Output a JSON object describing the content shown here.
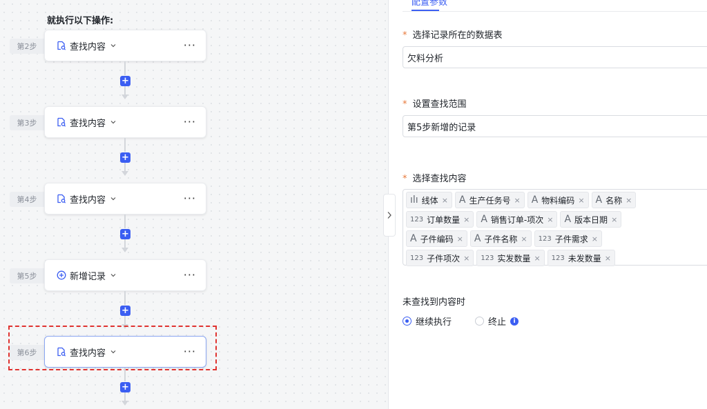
{
  "canvas": {
    "title": "就执行以下操作:",
    "steps": [
      {
        "badge": "第2步",
        "label": "查找内容",
        "icon": "find-content-icon"
      },
      {
        "badge": "第3步",
        "label": "查找内容",
        "icon": "find-content-icon"
      },
      {
        "badge": "第4步",
        "label": "查找内容",
        "icon": "find-content-icon"
      },
      {
        "badge": "第5步",
        "label": "新增记录",
        "icon": "add-record-icon"
      },
      {
        "badge": "第6步",
        "label": "查找内容",
        "icon": "find-content-icon"
      }
    ],
    "more": "···",
    "add": "+"
  },
  "panel": {
    "tab": "配置参数",
    "table_label": "选择记录所在的数据表",
    "table_value": "欠料分析",
    "scope_label": "设置查找范围",
    "scope_value": "第5步新增的记录",
    "content_label": "选择查找内容",
    "required_mark": "*",
    "tags": [
      [
        {
          "type": "chart",
          "type_glyph": "ılı",
          "label": "线体"
        },
        {
          "type": "text",
          "type_glyph": "A",
          "label": "生产任务号"
        },
        {
          "type": "text",
          "type_glyph": "A",
          "label": "物料编码"
        },
        {
          "type": "text",
          "type_glyph": "A",
          "label": "名称"
        }
      ],
      [
        {
          "type": "number",
          "type_glyph": "123",
          "label": "订单数量"
        },
        {
          "type": "text",
          "type_glyph": "A",
          "label": "销售订单-项次"
        },
        {
          "type": "text",
          "type_glyph": "A",
          "label": "版本日期"
        }
      ],
      [
        {
          "type": "text",
          "type_glyph": "A",
          "label": "子件编码"
        },
        {
          "type": "text",
          "type_glyph": "A",
          "label": "子件名称"
        },
        {
          "type": "number",
          "type_glyph": "123",
          "label": "子件需求"
        }
      ],
      [
        {
          "type": "number",
          "type_glyph": "123",
          "label": "子件项次"
        },
        {
          "type": "number",
          "type_glyph": "123",
          "label": "实发数量"
        },
        {
          "type": "number",
          "type_glyph": "123",
          "label": "未发数量"
        }
      ]
    ],
    "tag_close": "×",
    "not_found_label": "未查找到内容时",
    "option_continue": "继续执行",
    "option_stop": "终止",
    "info": "i"
  },
  "colors": {
    "accent": "#3b5ef2",
    "required": "#e8793a",
    "highlight": "#e0322f"
  }
}
